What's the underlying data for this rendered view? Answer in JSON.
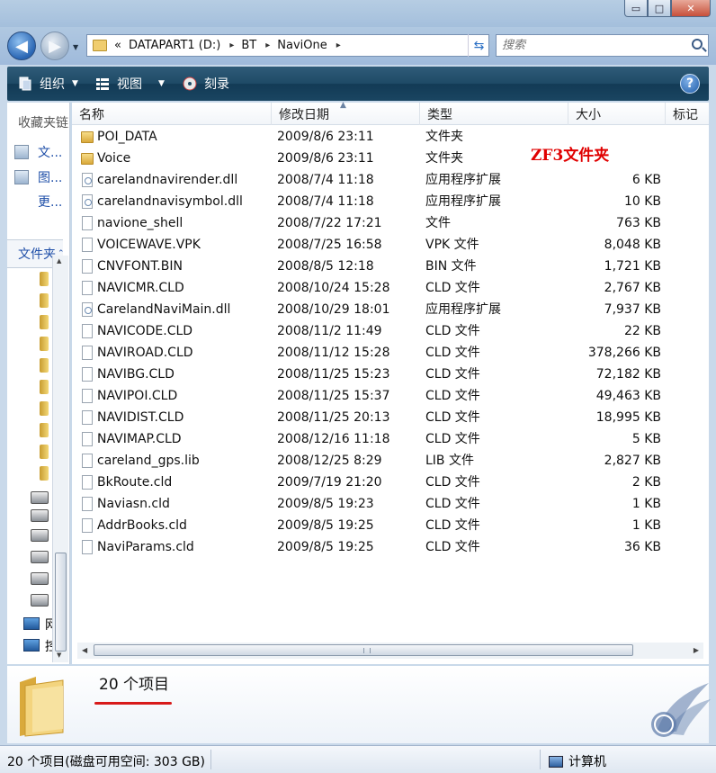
{
  "window": {
    "buttons": {
      "minimize": "▭",
      "maximize": "□",
      "close": "✕"
    }
  },
  "nav": {
    "back_icon": "◀",
    "forward_icon": "▶",
    "address": {
      "prefix": "«",
      "segments": [
        "DATAPART1 (D:)",
        "BT",
        "NaviOne"
      ],
      "separator": "▸"
    },
    "search_placeholder": "搜索"
  },
  "toolbar": {
    "organize": "组织",
    "views": "视图",
    "burn": "刻录",
    "help": "?"
  },
  "sidebar": {
    "favorites_header": "收藏夹链",
    "favorites": [
      "文...",
      "图...",
      "更..."
    ],
    "folders_header": "文件夹",
    "tree_truncated": [
      "网",
      "控"
    ]
  },
  "columns": {
    "name": "名称",
    "date": "修改日期",
    "type": "类型",
    "size": "大小",
    "tags": "标记"
  },
  "files": [
    {
      "name": "POI_DATA",
      "date": "2009/8/6 23:11",
      "type": "文件夹",
      "size": "",
      "icon": "folder-icon"
    },
    {
      "name": "Voice",
      "date": "2009/8/6 23:11",
      "type": "文件夹",
      "size": "",
      "icon": "folder-icon"
    },
    {
      "name": "carelandnavirender.dll",
      "date": "2008/7/4 11:18",
      "type": "应用程序扩展",
      "size": "6 KB",
      "icon": "dll-icon"
    },
    {
      "name": "carelandnavisymbol.dll",
      "date": "2008/7/4 11:18",
      "type": "应用程序扩展",
      "size": "10 KB",
      "icon": "dll-icon"
    },
    {
      "name": "navione_shell",
      "date": "2008/7/22 17:21",
      "type": "文件",
      "size": "763 KB",
      "icon": "file-icon"
    },
    {
      "name": "VOICEWAVE.VPK",
      "date": "2008/7/25 16:58",
      "type": "VPK 文件",
      "size": "8,048 KB",
      "icon": "file-icon"
    },
    {
      "name": "CNVFONT.BIN",
      "date": "2008/8/5 12:18",
      "type": "BIN 文件",
      "size": "1,721 KB",
      "icon": "file-icon"
    },
    {
      "name": "NAVICMR.CLD",
      "date": "2008/10/24 15:28",
      "type": "CLD 文件",
      "size": "2,767 KB",
      "icon": "file-icon"
    },
    {
      "name": "CarelandNaviMain.dll",
      "date": "2008/10/29 18:01",
      "type": "应用程序扩展",
      "size": "7,937 KB",
      "icon": "dll-icon"
    },
    {
      "name": "NAVICODE.CLD",
      "date": "2008/11/2 11:49",
      "type": "CLD 文件",
      "size": "22 KB",
      "icon": "file-icon"
    },
    {
      "name": "NAVIROAD.CLD",
      "date": "2008/11/12 15:28",
      "type": "CLD 文件",
      "size": "378,266 KB",
      "icon": "file-icon"
    },
    {
      "name": "NAVIBG.CLD",
      "date": "2008/11/25 15:23",
      "type": "CLD 文件",
      "size": "72,182 KB",
      "icon": "file-icon"
    },
    {
      "name": "NAVIPOI.CLD",
      "date": "2008/11/25 15:37",
      "type": "CLD 文件",
      "size": "49,463 KB",
      "icon": "file-icon"
    },
    {
      "name": "NAVIDIST.CLD",
      "date": "2008/11/25 20:13",
      "type": "CLD 文件",
      "size": "18,995 KB",
      "icon": "file-icon"
    },
    {
      "name": "NAVIMAP.CLD",
      "date": "2008/12/16 11:18",
      "type": "CLD 文件",
      "size": "5 KB",
      "icon": "file-icon"
    },
    {
      "name": "careland_gps.lib",
      "date": "2008/12/25 8:29",
      "type": "LIB 文件",
      "size": "2,827 KB",
      "icon": "file-icon"
    },
    {
      "name": "BkRoute.cld",
      "date": "2009/7/19 21:20",
      "type": "CLD 文件",
      "size": "2 KB",
      "icon": "file-icon"
    },
    {
      "name": "Naviasn.cld",
      "date": "2009/8/5 19:23",
      "type": "CLD 文件",
      "size": "1 KB",
      "icon": "file-icon"
    },
    {
      "name": "AddrBooks.cld",
      "date": "2009/8/5 19:25",
      "type": "CLD 文件",
      "size": "1 KB",
      "icon": "file-icon"
    },
    {
      "name": "NaviParams.cld",
      "date": "2009/8/5 19:25",
      "type": "CLD 文件",
      "size": "36 KB",
      "icon": "file-icon"
    }
  ],
  "annotation": "ZF3文件夹",
  "details": {
    "item_count": "20 个项目"
  },
  "status": {
    "left": "20 个项目(磁盘可用空间: 303 GB)",
    "computer": "计算机"
  },
  "colors": {
    "toolbar": "#1e4a66",
    "annotation": "#e00000",
    "link": "#1f4fa8"
  }
}
